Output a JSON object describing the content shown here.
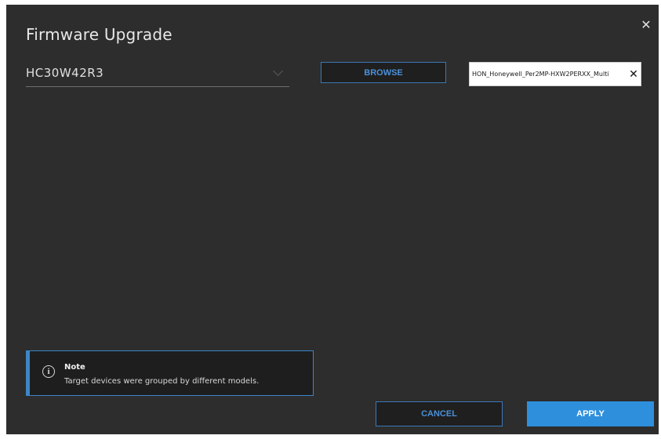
{
  "dialog": {
    "title": "Firmware Upgrade",
    "close_icon": "close-icon"
  },
  "model_select": {
    "value": "HC30W42R3",
    "icon": "chevron-down-icon"
  },
  "browse": {
    "label": "BROWSE"
  },
  "file": {
    "name": "HON_Honeywell_Per2MP-HXW2PERXX_Multi",
    "clear_icon": "close-icon"
  },
  "note": {
    "icon": "info-icon",
    "title": "Note",
    "text": "Target devices were grouped by different models."
  },
  "footer": {
    "cancel_label": "CANCEL",
    "apply_label": "APPLY"
  },
  "colors": {
    "background": "#2d2d2d",
    "accent": "#2e8fdc",
    "border_accent": "#3a78b8"
  }
}
